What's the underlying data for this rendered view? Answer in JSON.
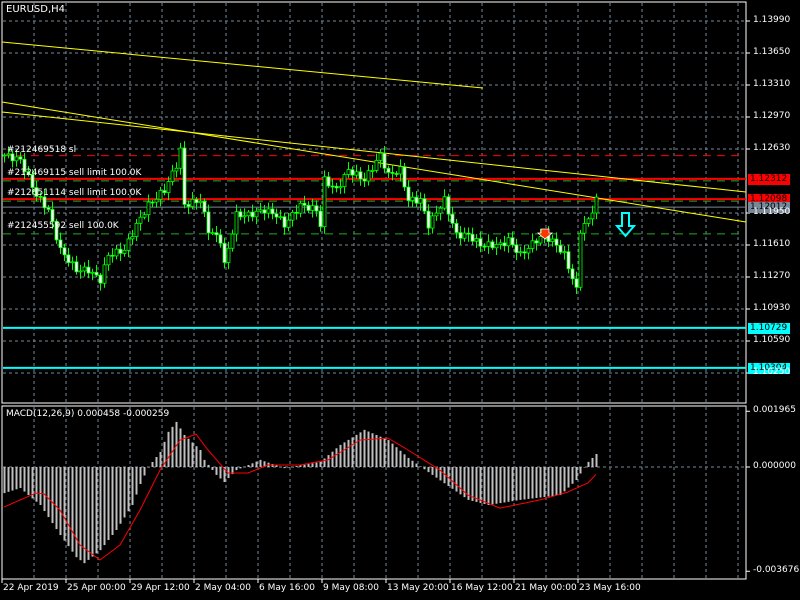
{
  "window": {
    "title": "EURUSD,H4"
  },
  "colors": {
    "bull": "#00ff00",
    "grid": "#778899",
    "red": "#ff0000",
    "cyan": "#00ffff",
    "yellow": "#ffff00",
    "histogram": "#c0c0c0"
  },
  "price_axis": {
    "ticks": [
      "1.13990",
      "1.13650",
      "1.13310",
      "1.12970",
      "1.12630",
      "1.11950",
      "1.11610",
      "1.11270",
      "1.10930",
      "1.10590",
      "1.10250"
    ],
    "levels": [
      {
        "label": "1.12312",
        "price": 1.12312,
        "color": "#ff0000"
      },
      {
        "label": "1.12098",
        "price": 1.12098,
        "color": "#ff0000"
      },
      {
        "label": "1.12012",
        "price": 1.12012,
        "color": "#778899"
      },
      {
        "label": "1.10729",
        "price": 1.10729,
        "color": "#00ffff"
      },
      {
        "label": "1.10304",
        "price": 1.10304,
        "color": "#00ffff"
      }
    ]
  },
  "orders": [
    {
      "text": "#212469518 sl",
      "price": 1.1256
    },
    {
      "text": "#212469115 sell limit 100.0K",
      "price": 1.12312
    },
    {
      "text": "#212651114 sell limit 100.0K",
      "price": 1.12098
    },
    {
      "text": "#212455592 sell 100.0K",
      "price": 1.1175
    }
  ],
  "time_axis": [
    "22 Apr 2019",
    "25 Apr 00:00",
    "29 Apr 12:00",
    "2 May 04:00",
    "6 May 16:00",
    "9 May 08:00",
    "13 May 20:00",
    "16 May 12:00",
    "21 May 00:00",
    "23 May 16:00"
  ],
  "macd": {
    "title": "MACD(12,26,9) 0.000458 -0.000259",
    "ticks": [
      "0.001965",
      "0.000000",
      "-0.003676"
    ],
    "histogram": [
      [
        0,
        -0.00092
      ],
      [
        4,
        -0.00074
      ],
      [
        6,
        -0.00099
      ],
      [
        9,
        -0.00134
      ],
      [
        14,
        -0.0024
      ],
      [
        18,
        -0.00318
      ],
      [
        20,
        -0.00339
      ],
      [
        24,
        -0.00293
      ],
      [
        28,
        -0.00222
      ],
      [
        32,
        -0.00134
      ],
      [
        34,
        -0.0006
      ],
      [
        36,
        0
      ],
      [
        39,
        0.00053
      ],
      [
        41,
        0.00124
      ],
      [
        43,
        0.00159
      ],
      [
        45,
        0.00113
      ],
      [
        49,
        0.0006
      ],
      [
        50,
        0.00025
      ],
      [
        53,
        -0.00028
      ],
      [
        55,
        -0.00053
      ],
      [
        58,
        -0.00011
      ],
      [
        64,
        0.00025
      ],
      [
        70,
        -4e-05
      ],
      [
        79,
        0.00018
      ],
      [
        84,
        0.00078
      ],
      [
        90,
        0.00131
      ],
      [
        96,
        0.00095
      ],
      [
        101,
        0.00032
      ],
      [
        106,
        -0.00018
      ],
      [
        116,
        -0.00116
      ],
      [
        121,
        -0.00134
      ],
      [
        129,
        -0.00116
      ],
      [
        139,
        -0.00099
      ],
      [
        143,
        -0.00046
      ],
      [
        145,
        0
      ],
      [
        146,
        0.00018
      ],
      [
        148,
        0.000458
      ]
    ],
    "signal": [
      [
        0,
        -0.00141
      ],
      [
        8,
        -0.00092
      ],
      [
        10,
        -0.00095
      ],
      [
        14,
        -0.00152
      ],
      [
        19,
        -0.00275
      ],
      [
        24,
        -0.00328
      ],
      [
        29,
        -0.00275
      ],
      [
        34,
        -0.00152
      ],
      [
        39,
        -0.00011
      ],
      [
        44,
        0.00095
      ],
      [
        48,
        0.00116
      ],
      [
        51,
        0.0006
      ],
      [
        56,
        -0.00021
      ],
      [
        61,
        -0.00021
      ],
      [
        66,
        7e-05
      ],
      [
        74,
        7e-05
      ],
      [
        81,
        0.00025
      ],
      [
        89,
        0.00095
      ],
      [
        96,
        0.00102
      ],
      [
        101,
        0.0006
      ],
      [
        109,
        -0.00011
      ],
      [
        116,
        -0.00099
      ],
      [
        124,
        -0.00145
      ],
      [
        134,
        -0.00116
      ],
      [
        141,
        -0.00088
      ],
      [
        146,
        -0.00056
      ],
      [
        148,
        -0.000259
      ]
    ]
  },
  "price_path": [
    [
      0,
      1.12566
    ],
    [
      4,
      1.12513
    ],
    [
      8,
      1.12141
    ],
    [
      11,
      1.11982
    ],
    [
      14,
      1.11557
    ],
    [
      18,
      1.11344
    ],
    [
      21,
      1.11344
    ],
    [
      24,
      1.11238
    ],
    [
      26,
      1.11504
    ],
    [
      30,
      1.11557
    ],
    [
      33,
      1.11823
    ],
    [
      36,
      1.12035
    ],
    [
      40,
      1.12194
    ],
    [
      43,
      1.1246
    ],
    [
      44,
      1.12619
    ],
    [
      45,
      1.12035
    ],
    [
      49,
      1.12088
    ],
    [
      51,
      1.11769
    ],
    [
      54,
      1.11663
    ],
    [
      55,
      1.11398
    ],
    [
      58,
      1.11929
    ],
    [
      61,
      1.11929
    ],
    [
      65,
      1.11982
    ],
    [
      68,
      1.11929
    ],
    [
      70,
      1.11823
    ],
    [
      74,
      1.12035
    ],
    [
      78,
      1.11982
    ],
    [
      79,
      1.11823
    ],
    [
      80,
      1.12301
    ],
    [
      83,
      1.12194
    ],
    [
      86,
      1.12407
    ],
    [
      90,
      1.12301
    ],
    [
      94,
      1.12566
    ],
    [
      96,
      1.12354
    ],
    [
      99,
      1.12407
    ],
    [
      101,
      1.12088
    ],
    [
      104,
      1.12088
    ],
    [
      106,
      1.11823
    ],
    [
      110,
      1.12088
    ],
    [
      113,
      1.11716
    ],
    [
      116,
      1.11716
    ],
    [
      119,
      1.1161
    ],
    [
      124,
      1.1161
    ],
    [
      126,
      1.11663
    ],
    [
      129,
      1.11504
    ],
    [
      133,
      1.11663
    ],
    [
      135,
      1.11716
    ],
    [
      138,
      1.1161
    ],
    [
      140,
      1.11504
    ],
    [
      143,
      1.11132
    ],
    [
      144,
      1.11769
    ],
    [
      146,
      1.11876
    ],
    [
      148,
      1.12088
    ]
  ]
}
